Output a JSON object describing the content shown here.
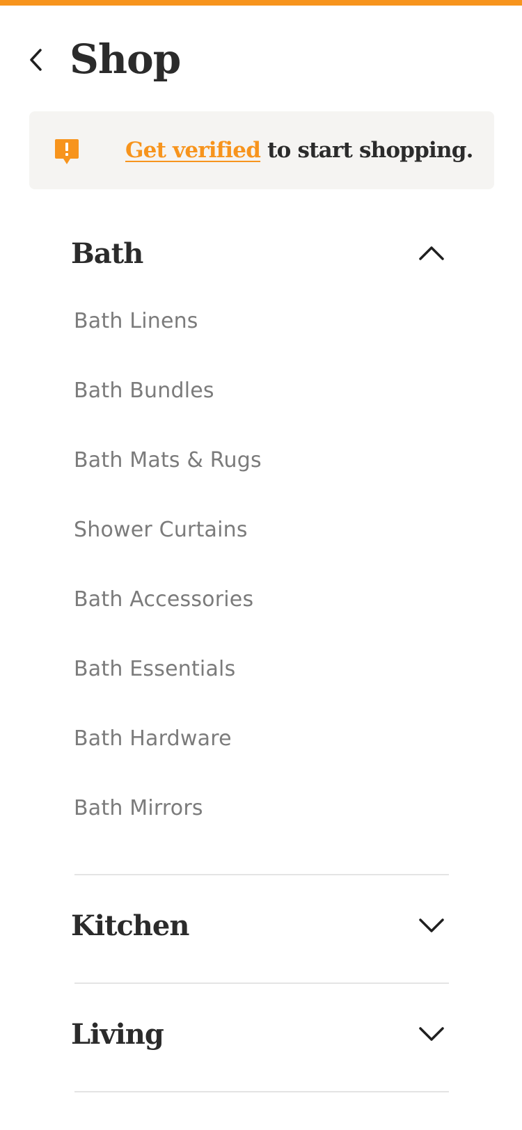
{
  "header": {
    "title": "Shop"
  },
  "banner": {
    "link_text": "Get verified",
    "rest_text": " to start shopping.",
    "icon": "alert-icon",
    "accent_color": "#f7941d"
  },
  "sections": [
    {
      "title": "Bath",
      "expanded": true,
      "items": [
        "Bath Linens",
        "Bath Bundles",
        "Bath Mats & Rugs",
        "Shower Curtains",
        "Bath Accessories",
        "Bath Essentials",
        "Bath Hardware",
        "Bath Mirrors"
      ]
    },
    {
      "title": "Kitchen",
      "expanded": false
    },
    {
      "title": "Living",
      "expanded": false
    }
  ]
}
